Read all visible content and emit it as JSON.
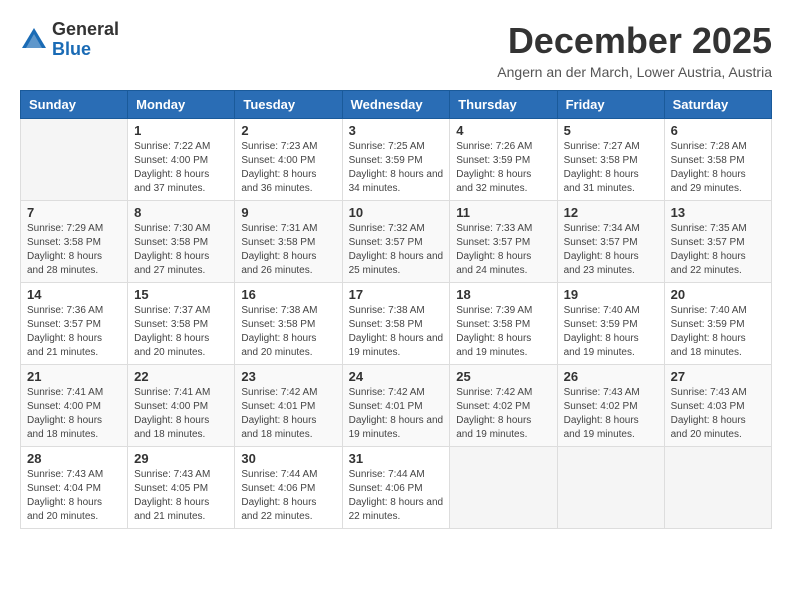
{
  "logo": {
    "general": "General",
    "blue": "Blue"
  },
  "title": "December 2025",
  "location": "Angern an der March, Lower Austria, Austria",
  "weekdays": [
    "Sunday",
    "Monday",
    "Tuesday",
    "Wednesday",
    "Thursday",
    "Friday",
    "Saturday"
  ],
  "weeks": [
    [
      {
        "day": "",
        "sunrise": "",
        "sunset": "",
        "daylight": ""
      },
      {
        "day": "1",
        "sunrise": "Sunrise: 7:22 AM",
        "sunset": "Sunset: 4:00 PM",
        "daylight": "Daylight: 8 hours and 37 minutes."
      },
      {
        "day": "2",
        "sunrise": "Sunrise: 7:23 AM",
        "sunset": "Sunset: 4:00 PM",
        "daylight": "Daylight: 8 hours and 36 minutes."
      },
      {
        "day": "3",
        "sunrise": "Sunrise: 7:25 AM",
        "sunset": "Sunset: 3:59 PM",
        "daylight": "Daylight: 8 hours and 34 minutes."
      },
      {
        "day": "4",
        "sunrise": "Sunrise: 7:26 AM",
        "sunset": "Sunset: 3:59 PM",
        "daylight": "Daylight: 8 hours and 32 minutes."
      },
      {
        "day": "5",
        "sunrise": "Sunrise: 7:27 AM",
        "sunset": "Sunset: 3:58 PM",
        "daylight": "Daylight: 8 hours and 31 minutes."
      },
      {
        "day": "6",
        "sunrise": "Sunrise: 7:28 AM",
        "sunset": "Sunset: 3:58 PM",
        "daylight": "Daylight: 8 hours and 29 minutes."
      }
    ],
    [
      {
        "day": "7",
        "sunrise": "Sunrise: 7:29 AM",
        "sunset": "Sunset: 3:58 PM",
        "daylight": "Daylight: 8 hours and 28 minutes."
      },
      {
        "day": "8",
        "sunrise": "Sunrise: 7:30 AM",
        "sunset": "Sunset: 3:58 PM",
        "daylight": "Daylight: 8 hours and 27 minutes."
      },
      {
        "day": "9",
        "sunrise": "Sunrise: 7:31 AM",
        "sunset": "Sunset: 3:58 PM",
        "daylight": "Daylight: 8 hours and 26 minutes."
      },
      {
        "day": "10",
        "sunrise": "Sunrise: 7:32 AM",
        "sunset": "Sunset: 3:57 PM",
        "daylight": "Daylight: 8 hours and 25 minutes."
      },
      {
        "day": "11",
        "sunrise": "Sunrise: 7:33 AM",
        "sunset": "Sunset: 3:57 PM",
        "daylight": "Daylight: 8 hours and 24 minutes."
      },
      {
        "day": "12",
        "sunrise": "Sunrise: 7:34 AM",
        "sunset": "Sunset: 3:57 PM",
        "daylight": "Daylight: 8 hours and 23 minutes."
      },
      {
        "day": "13",
        "sunrise": "Sunrise: 7:35 AM",
        "sunset": "Sunset: 3:57 PM",
        "daylight": "Daylight: 8 hours and 22 minutes."
      }
    ],
    [
      {
        "day": "14",
        "sunrise": "Sunrise: 7:36 AM",
        "sunset": "Sunset: 3:57 PM",
        "daylight": "Daylight: 8 hours and 21 minutes."
      },
      {
        "day": "15",
        "sunrise": "Sunrise: 7:37 AM",
        "sunset": "Sunset: 3:58 PM",
        "daylight": "Daylight: 8 hours and 20 minutes."
      },
      {
        "day": "16",
        "sunrise": "Sunrise: 7:38 AM",
        "sunset": "Sunset: 3:58 PM",
        "daylight": "Daylight: 8 hours and 20 minutes."
      },
      {
        "day": "17",
        "sunrise": "Sunrise: 7:38 AM",
        "sunset": "Sunset: 3:58 PM",
        "daylight": "Daylight: 8 hours and 19 minutes."
      },
      {
        "day": "18",
        "sunrise": "Sunrise: 7:39 AM",
        "sunset": "Sunset: 3:58 PM",
        "daylight": "Daylight: 8 hours and 19 minutes."
      },
      {
        "day": "19",
        "sunrise": "Sunrise: 7:40 AM",
        "sunset": "Sunset: 3:59 PM",
        "daylight": "Daylight: 8 hours and 19 minutes."
      },
      {
        "day": "20",
        "sunrise": "Sunrise: 7:40 AM",
        "sunset": "Sunset: 3:59 PM",
        "daylight": "Daylight: 8 hours and 18 minutes."
      }
    ],
    [
      {
        "day": "21",
        "sunrise": "Sunrise: 7:41 AM",
        "sunset": "Sunset: 4:00 PM",
        "daylight": "Daylight: 8 hours and 18 minutes."
      },
      {
        "day": "22",
        "sunrise": "Sunrise: 7:41 AM",
        "sunset": "Sunset: 4:00 PM",
        "daylight": "Daylight: 8 hours and 18 minutes."
      },
      {
        "day": "23",
        "sunrise": "Sunrise: 7:42 AM",
        "sunset": "Sunset: 4:01 PM",
        "daylight": "Daylight: 8 hours and 18 minutes."
      },
      {
        "day": "24",
        "sunrise": "Sunrise: 7:42 AM",
        "sunset": "Sunset: 4:01 PM",
        "daylight": "Daylight: 8 hours and 19 minutes."
      },
      {
        "day": "25",
        "sunrise": "Sunrise: 7:42 AM",
        "sunset": "Sunset: 4:02 PM",
        "daylight": "Daylight: 8 hours and 19 minutes."
      },
      {
        "day": "26",
        "sunrise": "Sunrise: 7:43 AM",
        "sunset": "Sunset: 4:02 PM",
        "daylight": "Daylight: 8 hours and 19 minutes."
      },
      {
        "day": "27",
        "sunrise": "Sunrise: 7:43 AM",
        "sunset": "Sunset: 4:03 PM",
        "daylight": "Daylight: 8 hours and 20 minutes."
      }
    ],
    [
      {
        "day": "28",
        "sunrise": "Sunrise: 7:43 AM",
        "sunset": "Sunset: 4:04 PM",
        "daylight": "Daylight: 8 hours and 20 minutes."
      },
      {
        "day": "29",
        "sunrise": "Sunrise: 7:43 AM",
        "sunset": "Sunset: 4:05 PM",
        "daylight": "Daylight: 8 hours and 21 minutes."
      },
      {
        "day": "30",
        "sunrise": "Sunrise: 7:44 AM",
        "sunset": "Sunset: 4:06 PM",
        "daylight": "Daylight: 8 hours and 22 minutes."
      },
      {
        "day": "31",
        "sunrise": "Sunrise: 7:44 AM",
        "sunset": "Sunset: 4:06 PM",
        "daylight": "Daylight: 8 hours and 22 minutes."
      },
      {
        "day": "",
        "sunrise": "",
        "sunset": "",
        "daylight": ""
      },
      {
        "day": "",
        "sunrise": "",
        "sunset": "",
        "daylight": ""
      },
      {
        "day": "",
        "sunrise": "",
        "sunset": "",
        "daylight": ""
      }
    ]
  ]
}
